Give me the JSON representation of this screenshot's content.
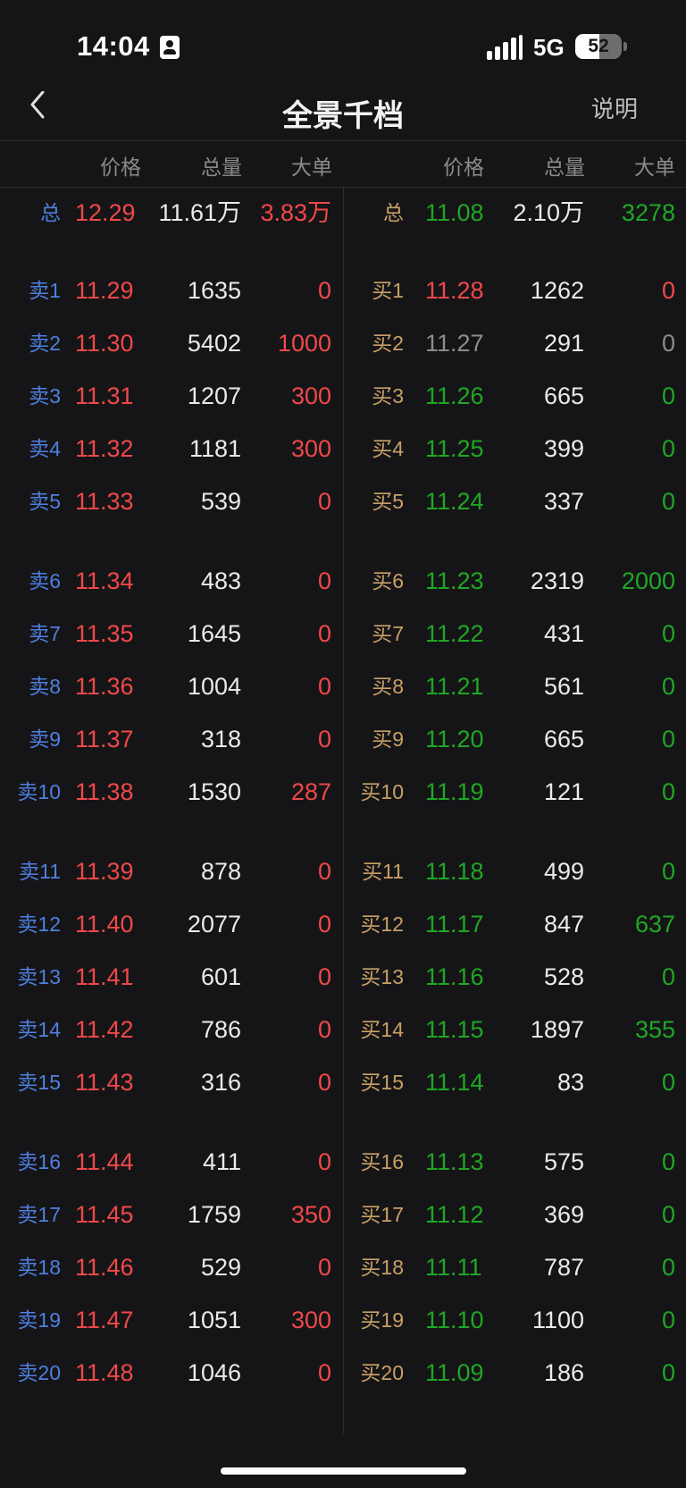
{
  "status": {
    "time": "14:04",
    "network": "5G",
    "battery": "52",
    "battery_level": 0.52
  },
  "nav": {
    "title": "全景千档",
    "help": "说明"
  },
  "columns": {
    "price": "价格",
    "volume": "总量",
    "big": "大单"
  },
  "colors": {
    "red": "#f04848",
    "green": "#1fa724",
    "sell_label": "#4f7fe0",
    "buy_label": "#c8a066",
    "grey": "#8c8c8e"
  },
  "totals": {
    "sell": {
      "label": "总",
      "price": "12.29",
      "volume": "11.61万",
      "big": "3.83万"
    },
    "buy": {
      "label": "总",
      "price": "11.08",
      "volume": "2.10万",
      "big": "3278"
    }
  },
  "sell": [
    {
      "label": "卖1",
      "price": "11.29",
      "volume": "1635",
      "big": "0"
    },
    {
      "label": "卖2",
      "price": "11.30",
      "volume": "5402",
      "big": "1000"
    },
    {
      "label": "卖3",
      "price": "11.31",
      "volume": "1207",
      "big": "300"
    },
    {
      "label": "卖4",
      "price": "11.32",
      "volume": "1181",
      "big": "300"
    },
    {
      "label": "卖5",
      "price": "11.33",
      "volume": "539",
      "big": "0"
    },
    {
      "label": "卖6",
      "price": "11.34",
      "volume": "483",
      "big": "0"
    },
    {
      "label": "卖7",
      "price": "11.35",
      "volume": "1645",
      "big": "0"
    },
    {
      "label": "卖8",
      "price": "11.36",
      "volume": "1004",
      "big": "0"
    },
    {
      "label": "卖9",
      "price": "11.37",
      "volume": "318",
      "big": "0"
    },
    {
      "label": "卖10",
      "price": "11.38",
      "volume": "1530",
      "big": "287"
    },
    {
      "label": "卖11",
      "price": "11.39",
      "volume": "878",
      "big": "0"
    },
    {
      "label": "卖12",
      "price": "11.40",
      "volume": "2077",
      "big": "0"
    },
    {
      "label": "卖13",
      "price": "11.41",
      "volume": "601",
      "big": "0"
    },
    {
      "label": "卖14",
      "price": "11.42",
      "volume": "786",
      "big": "0"
    },
    {
      "label": "卖15",
      "price": "11.43",
      "volume": "316",
      "big": "0"
    },
    {
      "label": "卖16",
      "price": "11.44",
      "volume": "411",
      "big": "0"
    },
    {
      "label": "卖17",
      "price": "11.45",
      "volume": "1759",
      "big": "350"
    },
    {
      "label": "卖18",
      "price": "11.46",
      "volume": "529",
      "big": "0"
    },
    {
      "label": "卖19",
      "price": "11.47",
      "volume": "1051",
      "big": "300"
    },
    {
      "label": "卖20",
      "price": "11.48",
      "volume": "1046",
      "big": "0"
    }
  ],
  "buy": [
    {
      "label": "买1",
      "price": "11.28",
      "volume": "1262",
      "big": "0",
      "color": "red"
    },
    {
      "label": "买2",
      "price": "11.27",
      "volume": "291",
      "big": "0",
      "color": "grey"
    },
    {
      "label": "买3",
      "price": "11.26",
      "volume": "665",
      "big": "0",
      "color": "green"
    },
    {
      "label": "买4",
      "price": "11.25",
      "volume": "399",
      "big": "0",
      "color": "green"
    },
    {
      "label": "买5",
      "price": "11.24",
      "volume": "337",
      "big": "0",
      "color": "green"
    },
    {
      "label": "买6",
      "price": "11.23",
      "volume": "2319",
      "big": "2000",
      "color": "green"
    },
    {
      "label": "买7",
      "price": "11.22",
      "volume": "431",
      "big": "0",
      "color": "green"
    },
    {
      "label": "买8",
      "price": "11.21",
      "volume": "561",
      "big": "0",
      "color": "green"
    },
    {
      "label": "买9",
      "price": "11.20",
      "volume": "665",
      "big": "0",
      "color": "green"
    },
    {
      "label": "买10",
      "price": "11.19",
      "volume": "121",
      "big": "0",
      "color": "green"
    },
    {
      "label": "买11",
      "price": "11.18",
      "volume": "499",
      "big": "0",
      "color": "green"
    },
    {
      "label": "买12",
      "price": "11.17",
      "volume": "847",
      "big": "637",
      "color": "green"
    },
    {
      "label": "买13",
      "price": "11.16",
      "volume": "528",
      "big": "0",
      "color": "green"
    },
    {
      "label": "买14",
      "price": "11.15",
      "volume": "1897",
      "big": "355",
      "color": "green"
    },
    {
      "label": "买15",
      "price": "11.14",
      "volume": "83",
      "big": "0",
      "color": "green"
    },
    {
      "label": "买16",
      "price": "11.13",
      "volume": "575",
      "big": "0",
      "color": "green"
    },
    {
      "label": "买17",
      "price": "11.12",
      "volume": "369",
      "big": "0",
      "color": "green"
    },
    {
      "label": "买18",
      "price": "11.11",
      "volume": "787",
      "big": "0",
      "color": "green"
    },
    {
      "label": "买19",
      "price": "11.10",
      "volume": "1100",
      "big": "0",
      "color": "green"
    },
    {
      "label": "买20",
      "price": "11.09",
      "volume": "186",
      "big": "0",
      "color": "green"
    }
  ]
}
